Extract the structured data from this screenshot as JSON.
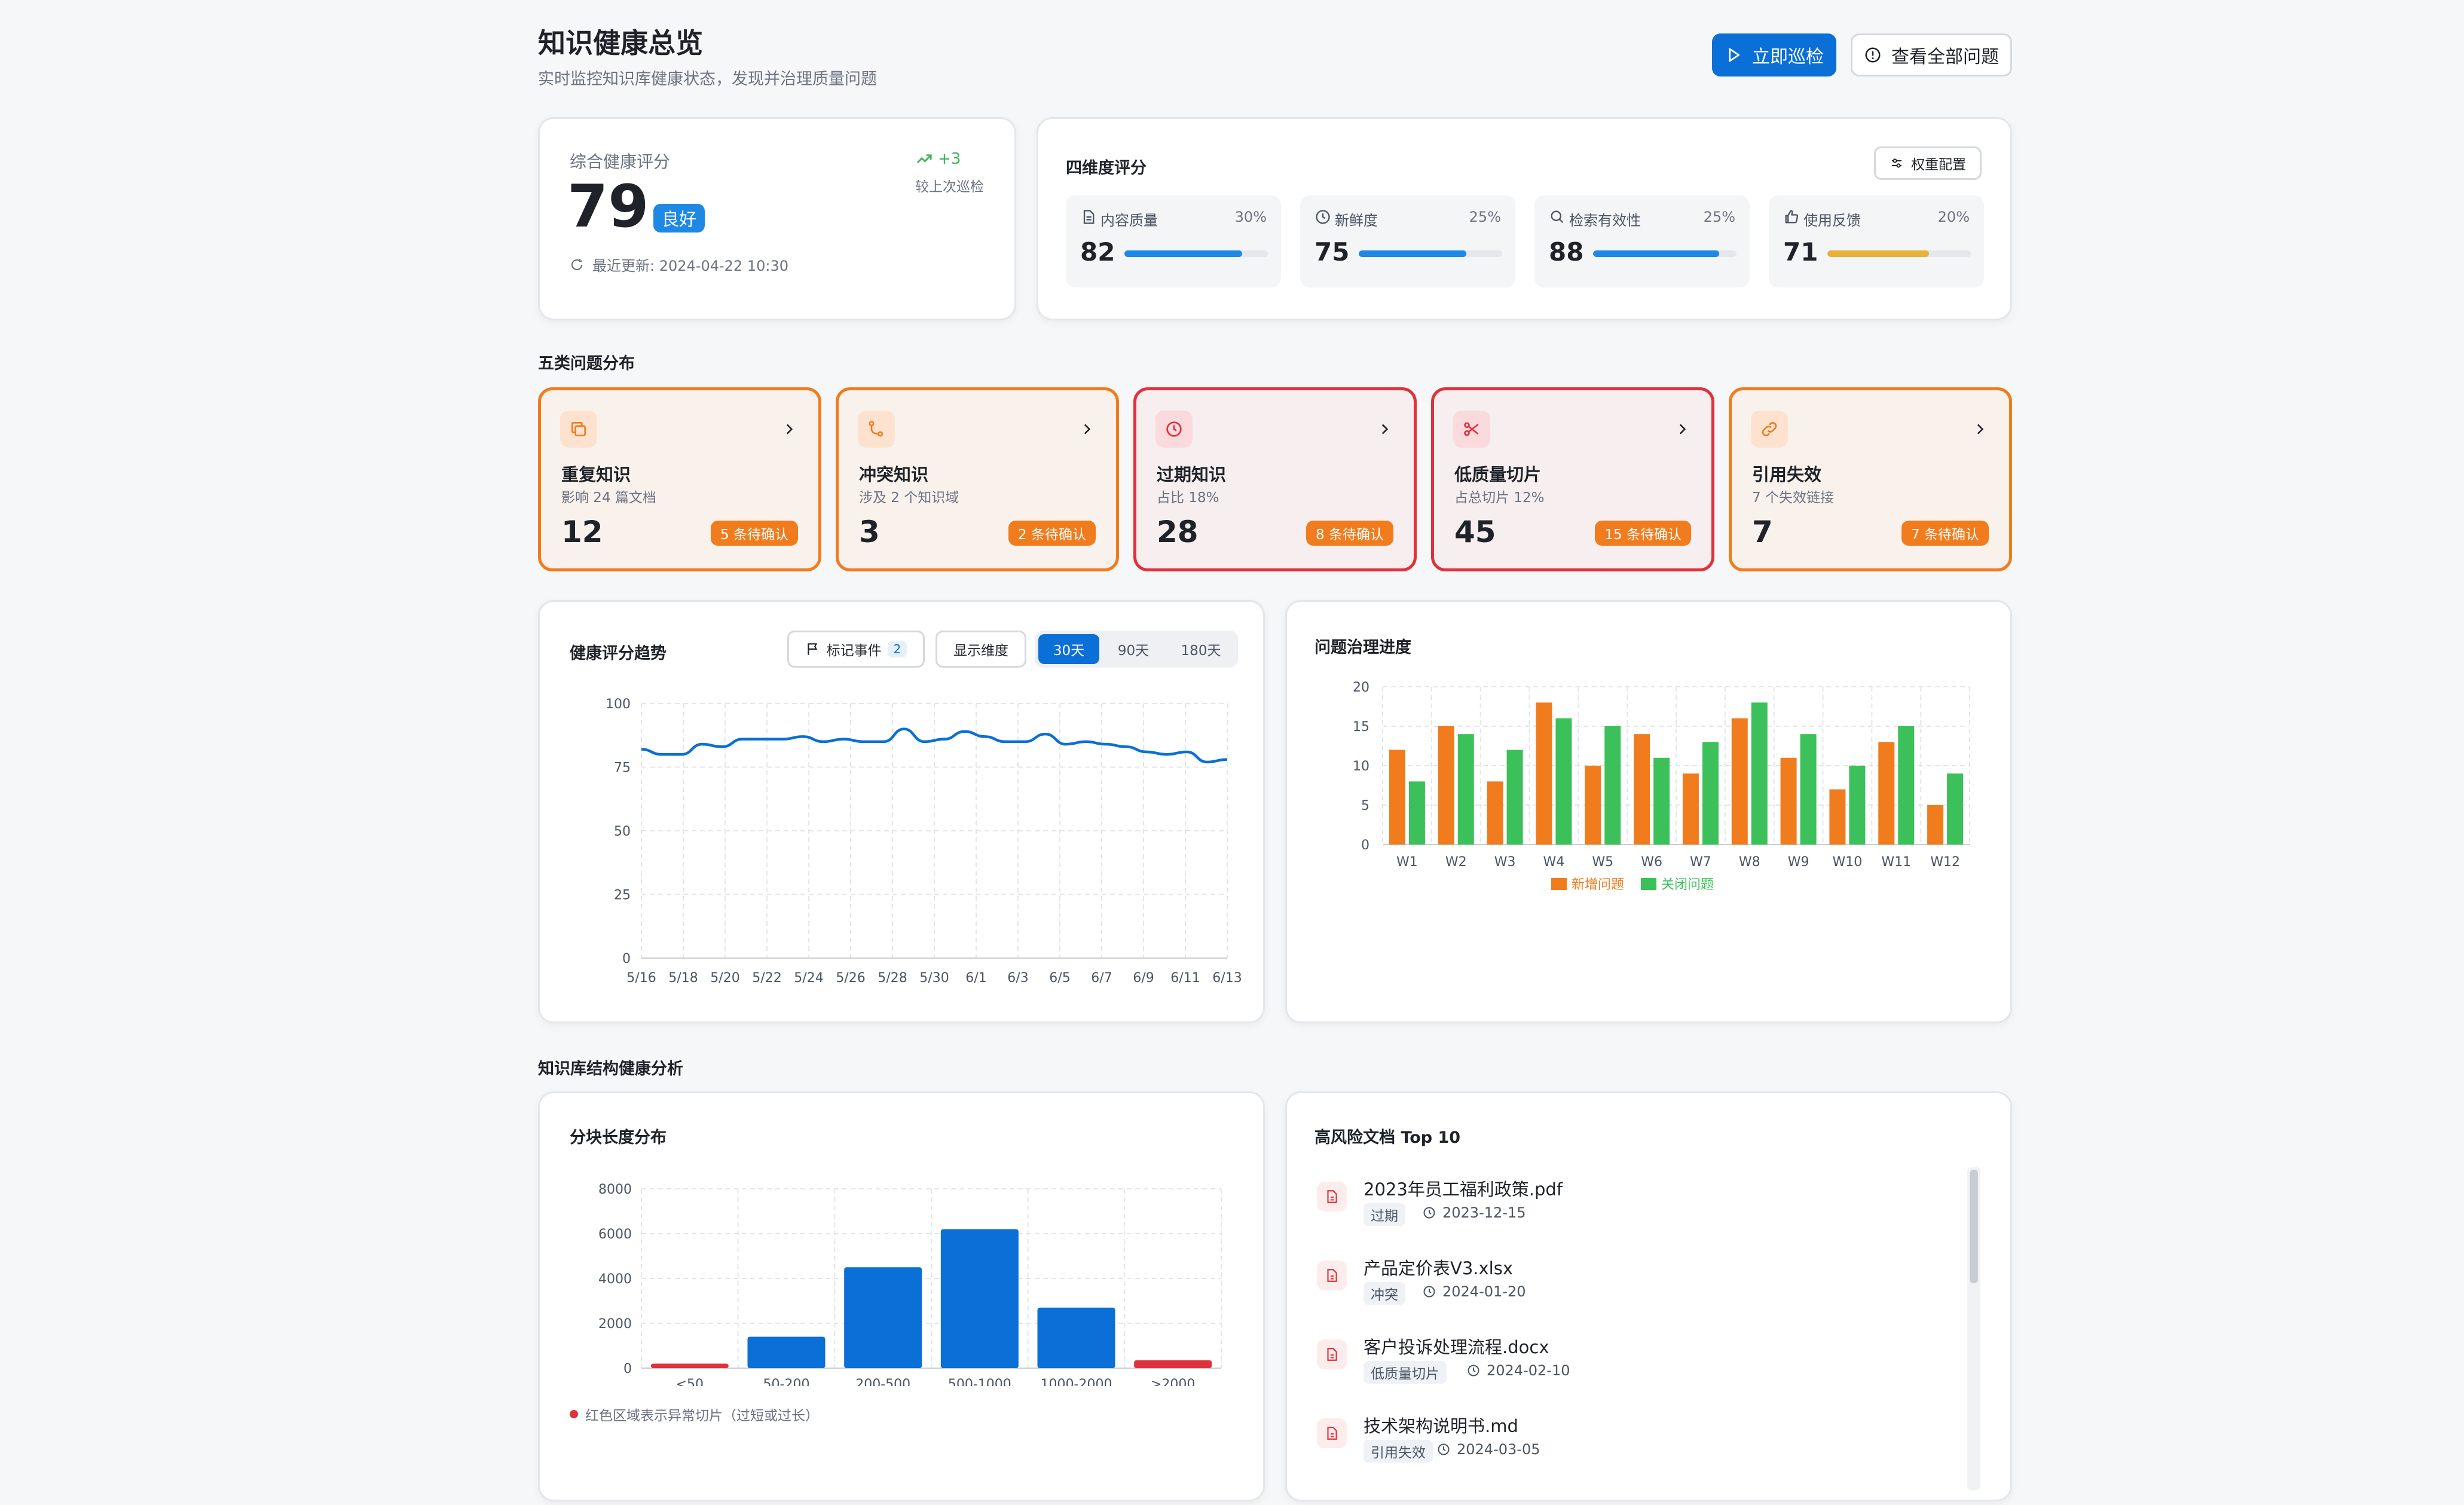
{
  "header": {
    "title": "知识健康总览",
    "subtitle": "实时监控知识库健康状态，发现并治理质量问题",
    "patrol_button": "立即巡检",
    "view_all_button": "查看全部问题"
  },
  "overall": {
    "label": "综合健康评分",
    "score": "79",
    "level": "良好",
    "delta": "+3",
    "delta_label": "较上次巡检",
    "updated": "最近更新: 2024-04-22 10:30"
  },
  "dimensions": {
    "title": "四维度评分",
    "config_button": "权重配置",
    "items": [
      {
        "name": "内容质量",
        "weight": "30%",
        "score": "82",
        "value": 82,
        "color": "#1e88e5"
      },
      {
        "name": "新鲜度",
        "weight": "25%",
        "score": "75",
        "value": 75,
        "color": "#1e88e5"
      },
      {
        "name": "检索有效性",
        "weight": "25%",
        "score": "88",
        "value": 88,
        "color": "#1e88e5"
      },
      {
        "name": "使用反馈",
        "weight": "20%",
        "score": "71",
        "value": 71,
        "color": "#e8b23a"
      }
    ]
  },
  "problems": {
    "title": "五类问题分布",
    "items": [
      {
        "title": "重复知识",
        "sub": "影响 24 篇文档",
        "count": "12",
        "badge": "5 条待确认",
        "icon": "copy-icon"
      },
      {
        "title": "冲突知识",
        "sub": "涉及 2 个知识域",
        "count": "3",
        "badge": "2 条待确认",
        "icon": "git-branch-icon"
      },
      {
        "title": "过期知识",
        "sub": "占比 18%",
        "count": "28",
        "badge": "8 条待确认",
        "icon": "clock-icon"
      },
      {
        "title": "低质量切片",
        "sub": "占总切片 12%",
        "count": "45",
        "badge": "15 条待确认",
        "icon": "scissors-icon"
      },
      {
        "title": "引用失效",
        "sub": "7 个失效链接",
        "count": "7",
        "badge": "7 条待确认",
        "icon": "link-icon"
      }
    ],
    "colors": {
      "orange": "#f07c1e",
      "red": "#e0323c"
    }
  },
  "trend": {
    "title": "健康评分趋势",
    "events_button": "标记事件",
    "events_count": "2",
    "dims_button": "显示维度",
    "ranges": [
      "30天",
      "90天",
      "180天"
    ],
    "active_range": "30天"
  },
  "progress": {
    "title": "问题治理进度"
  },
  "structure": {
    "title": "知识库结构健康分析",
    "chunk_title": "分块长度分布",
    "chunk_note": "红色区域表示异常切片（过短或过长）"
  },
  "risk": {
    "title": "高风险文档 Top 10",
    "items": [
      {
        "name": "2023年员工福利政策.pdf",
        "tag": "过期",
        "date": "2023-12-15"
      },
      {
        "name": "产品定价表V3.xlsx",
        "tag": "冲突",
        "date": "2024-01-20"
      },
      {
        "name": "客户投诉处理流程.docx",
        "tag": "低质量切片",
        "date": "2024-02-10"
      },
      {
        "name": "技术架构说明书.md",
        "tag": "引用失效",
        "date": "2024-03-05"
      }
    ]
  },
  "chart_data": [
    {
      "type": "line",
      "title": "健康评分趋势",
      "x": [
        "5/16",
        "5/17",
        "5/18",
        "5/19",
        "5/20",
        "5/21",
        "5/22",
        "5/23",
        "5/24",
        "5/25",
        "5/26",
        "5/27",
        "5/28",
        "5/29",
        "5/30",
        "5/31",
        "6/1",
        "6/2",
        "6/3",
        "6/4",
        "6/5",
        "6/6",
        "6/7",
        "6/8",
        "6/9",
        "6/10",
        "6/11",
        "6/12",
        "6/13"
      ],
      "x_tick_labels": [
        "5/16",
        "5/18",
        "5/20",
        "5/22",
        "5/24",
        "5/26",
        "5/28",
        "5/30",
        "6/1",
        "6/3",
        "6/5",
        "6/7",
        "6/9",
        "6/11",
        "6/13"
      ],
      "series": [
        {
          "values": [
            82,
            80,
            80,
            84,
            83,
            86,
            86,
            86,
            87,
            85,
            86,
            85,
            85,
            90,
            85,
            86,
            89,
            87,
            85,
            85,
            88,
            84,
            85,
            84,
            83,
            81,
            80,
            81,
            77,
            78
          ]
        }
      ],
      "ylim": [
        0,
        100
      ],
      "yticks": [
        0,
        25,
        50,
        75,
        100
      ],
      "grid": true,
      "color": "#0a6fd6"
    },
    {
      "type": "bar",
      "title": "问题治理进度",
      "categories": [
        "W1",
        "W2",
        "W3",
        "W4",
        "W5",
        "W6",
        "W7",
        "W8",
        "W9",
        "W10",
        "W11",
        "W12"
      ],
      "series": [
        {
          "name": "新增问题",
          "values": [
            12,
            15,
            8,
            18,
            10,
            14,
            9,
            16,
            11,
            7,
            13,
            5
          ],
          "color": "#f07c1e"
        },
        {
          "name": "关闭问题",
          "values": [
            8,
            14,
            12,
            16,
            15,
            11,
            13,
            18,
            14,
            10,
            15,
            9
          ],
          "color": "#3cc05a"
        }
      ],
      "ylim": [
        0,
        20
      ],
      "yticks": [
        0,
        5,
        10,
        15,
        20
      ],
      "legend": "bottom",
      "grid": true
    },
    {
      "type": "bar",
      "title": "分块长度分布",
      "categories": [
        "<50",
        "50-200",
        "200-500",
        "500-1000",
        "1000-2000",
        ">2000"
      ],
      "values": [
        200,
        1400,
        4500,
        6200,
        2700,
        350
      ],
      "colors": [
        "#e0323c",
        "#0a6fd6",
        "#0a6fd6",
        "#0a6fd6",
        "#0a6fd6",
        "#e0323c"
      ],
      "ylim": [
        0,
        8000
      ],
      "yticks": [
        0,
        2000,
        4000,
        6000,
        8000
      ],
      "grid": true
    }
  ]
}
